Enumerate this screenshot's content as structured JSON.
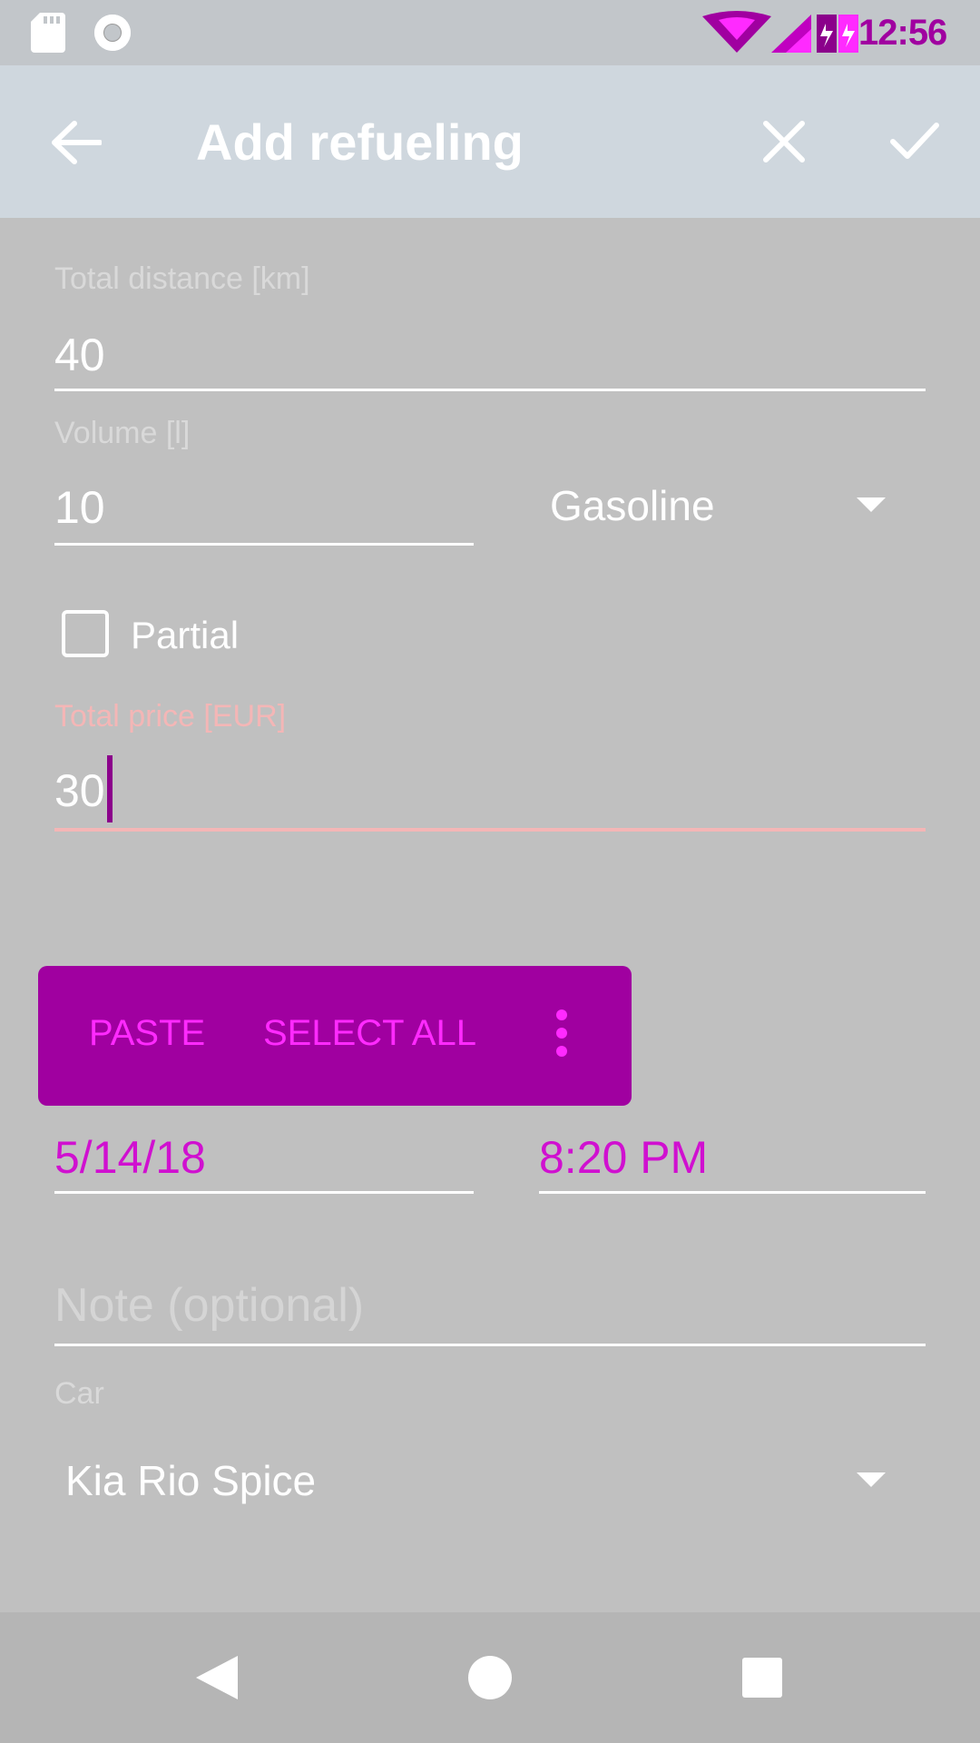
{
  "status_bar": {
    "time": "12:56",
    "icons": [
      "sd-card-icon",
      "circle-icon",
      "wifi-icon",
      "signal-icon",
      "battery-icon"
    ]
  },
  "toolbar": {
    "title": "Add refueling"
  },
  "form": {
    "distance": {
      "label": "Total distance [km]",
      "value": "40"
    },
    "volume": {
      "label": "Volume [l]",
      "value": "10"
    },
    "fuel_type": {
      "selected": "Gasoline"
    },
    "partial": {
      "label": "Partial",
      "checked": false
    },
    "price": {
      "label": "Total price [EUR]",
      "value": "30",
      "accent_color": "#f4b6b6"
    },
    "date": {
      "value": "5/14/18"
    },
    "time": {
      "value": "8:20 PM"
    },
    "note": {
      "placeholder": "Note (optional)"
    },
    "car": {
      "label": "Car",
      "selected": "Kia Rio Spice"
    }
  },
  "context_menu": {
    "paste": "PASTE",
    "select_all": "SELECT ALL"
  },
  "colors": {
    "background": "#c0c0c0",
    "toolbar": "#cfd7de",
    "popup": "#a000a0",
    "popup_text": "#ff2aff",
    "navbar": "#b5b5b5"
  }
}
